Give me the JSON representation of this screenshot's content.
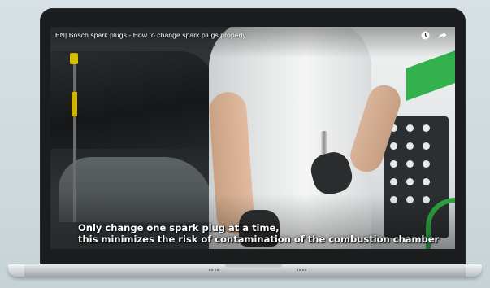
{
  "video": {
    "title": "EN| Bosch spark plugs - How to change spark plugs properly",
    "icons": [
      "watch-later-icon",
      "share-icon"
    ],
    "subtitles": [
      "Only change one spark plug at a time,",
      "this minimizes the risk of contamination of the combustion chamber"
    ]
  },
  "colors": {
    "accent_green": "#33b14d",
    "background": "#cfd9de"
  }
}
